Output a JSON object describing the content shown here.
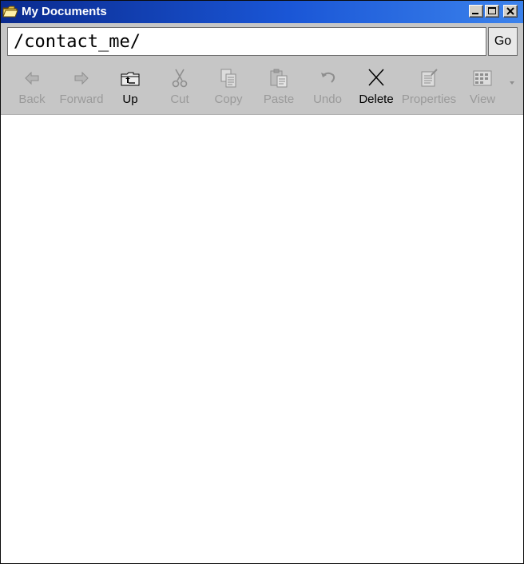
{
  "window": {
    "title": "My Documents",
    "title_icon": "folder-icon",
    "controls": {
      "minimize": "minimize-icon",
      "maximize": "maximize-icon",
      "close": "close-icon"
    }
  },
  "address": {
    "value": "/contact_me/",
    "go_label": "Go"
  },
  "toolbar": {
    "items": [
      {
        "label": "Back",
        "icon": "back-arrow-icon",
        "enabled": false
      },
      {
        "label": "Forward",
        "icon": "forward-arrow-icon",
        "enabled": false
      },
      {
        "label": "Up",
        "icon": "up-folder-icon",
        "enabled": true
      },
      {
        "label": "Cut",
        "icon": "scissors-icon",
        "enabled": false
      },
      {
        "label": "Copy",
        "icon": "copy-icon",
        "enabled": false
      },
      {
        "label": "Paste",
        "icon": "paste-icon",
        "enabled": false
      },
      {
        "label": "Undo",
        "icon": "undo-icon",
        "enabled": false
      },
      {
        "label": "Delete",
        "icon": "delete-x-icon",
        "enabled": true
      },
      {
        "label": "Properties",
        "icon": "properties-icon",
        "enabled": false
      },
      {
        "label": "View",
        "icon": "view-icon",
        "enabled": false
      }
    ],
    "overflow_icon": "chevron-down-icon"
  },
  "colors": {
    "titlebar_start": "#0a2a8e",
    "titlebar_end": "#3b82ec",
    "toolbar_bg": "#c6c6c6",
    "disabled_text": "#9a9a9a",
    "enabled_text": "#000000"
  }
}
